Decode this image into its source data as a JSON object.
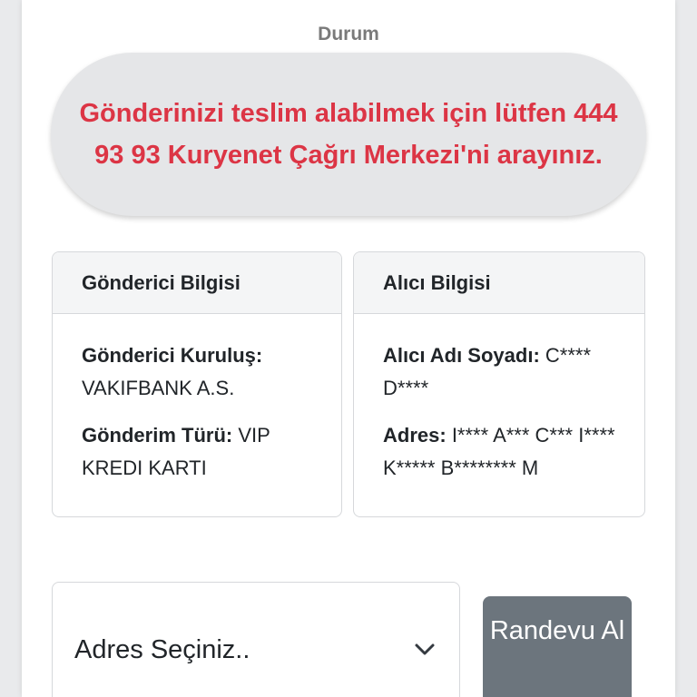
{
  "status": {
    "label": "Durum",
    "message": "Gönderinizi teslim alabilmek için lütfen 444 93 93 Kuryenet Çağrı Merkezi'ni arayınız.",
    "message_color": "#dc3545"
  },
  "sender": {
    "title": "Gönderici Bilgisi",
    "org_label": "Gönderici Kuruluş:",
    "org_value": "VAKIFBANK A.S.",
    "type_label": "Gönderim Türü:",
    "type_value": "VIP KREDI KARTI"
  },
  "receiver": {
    "title": "Alıcı Bilgisi",
    "name_label": "Alıcı Adı Soyadı:",
    "name_value": "C**** D****",
    "address_label": "Adres:",
    "address_value": "I**** A*** C*** I**** K***** B******** M"
  },
  "form": {
    "address_select": "Adres Seçiniz..",
    "chevron_icon": "chevron-down-icon",
    "appointment_button": "Randevu Al",
    "button_color": "#6c757d"
  }
}
